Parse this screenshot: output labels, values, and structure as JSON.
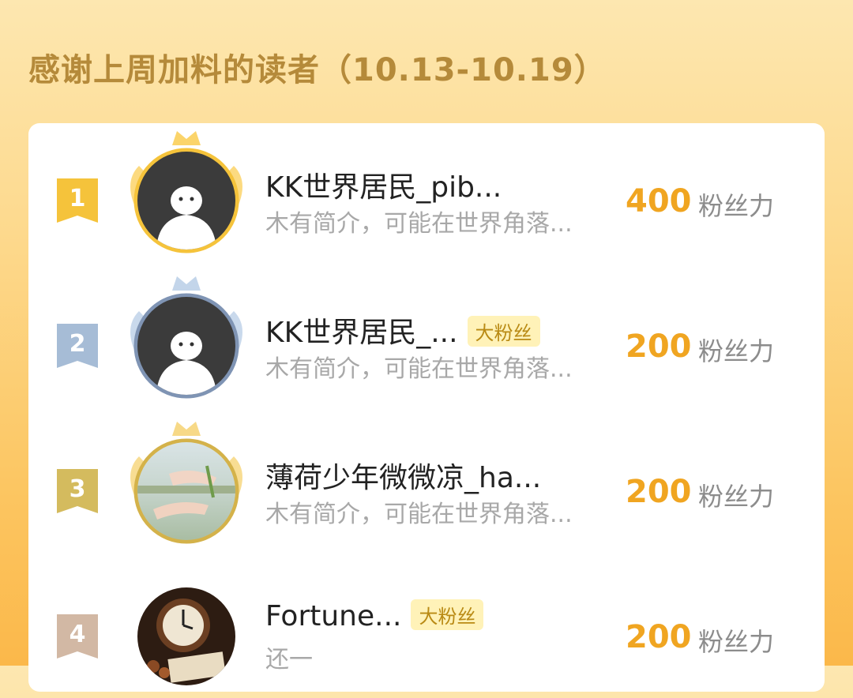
{
  "header": {
    "title": "感谢上周加料的读者（10.13-10.19）"
  },
  "ranking": [
    {
      "rank": "1",
      "name": "KK世界居民_pib...",
      "badge": "",
      "desc": "木有简介，可能在世界角落...",
      "score": "400",
      "unit": "粉丝力",
      "avatar_icon": "default-avatar-icon",
      "rank_color": "#f5c33b"
    },
    {
      "rank": "2",
      "name": "KK世界居民_...",
      "badge": "大粉丝",
      "desc": "木有简介，可能在世界角落...",
      "score": "200",
      "unit": "粉丝力",
      "avatar_icon": "default-avatar-icon",
      "rank_color": "#a6bcd6"
    },
    {
      "rank": "3",
      "name": "薄荷少年微微凉_ha...",
      "badge": "",
      "desc": "木有简介，可能在世界角落...",
      "score": "200",
      "unit": "粉丝力",
      "avatar_icon": "photo-avatar-hands",
      "rank_color": "#d4bb5e"
    },
    {
      "rank": "4",
      "name": "Fortune...",
      "badge": "大粉丝",
      "desc": "还一",
      "score": "200",
      "unit": "粉丝力",
      "avatar_icon": "photo-avatar-clock",
      "rank_color": "#d2b8a4"
    }
  ]
}
